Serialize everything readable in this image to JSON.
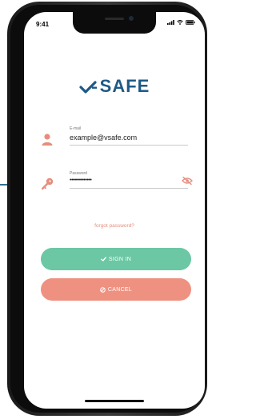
{
  "status_bar": {
    "time": "9:41"
  },
  "app": {
    "logo_text": "SAFE"
  },
  "email": {
    "label": "E-mail",
    "value": "example@vsafe.com"
  },
  "password": {
    "label": "Password",
    "value": "••••••••••••••"
  },
  "forgot_password": "forgot password?",
  "buttons": {
    "signin": "SIGN IN",
    "cancel": "CANCEL"
  },
  "colors": {
    "brand": "#1e5a86",
    "accent_green": "#6bc7a4",
    "accent_coral": "#ef9181",
    "icon_coral": "#e58e7d"
  }
}
